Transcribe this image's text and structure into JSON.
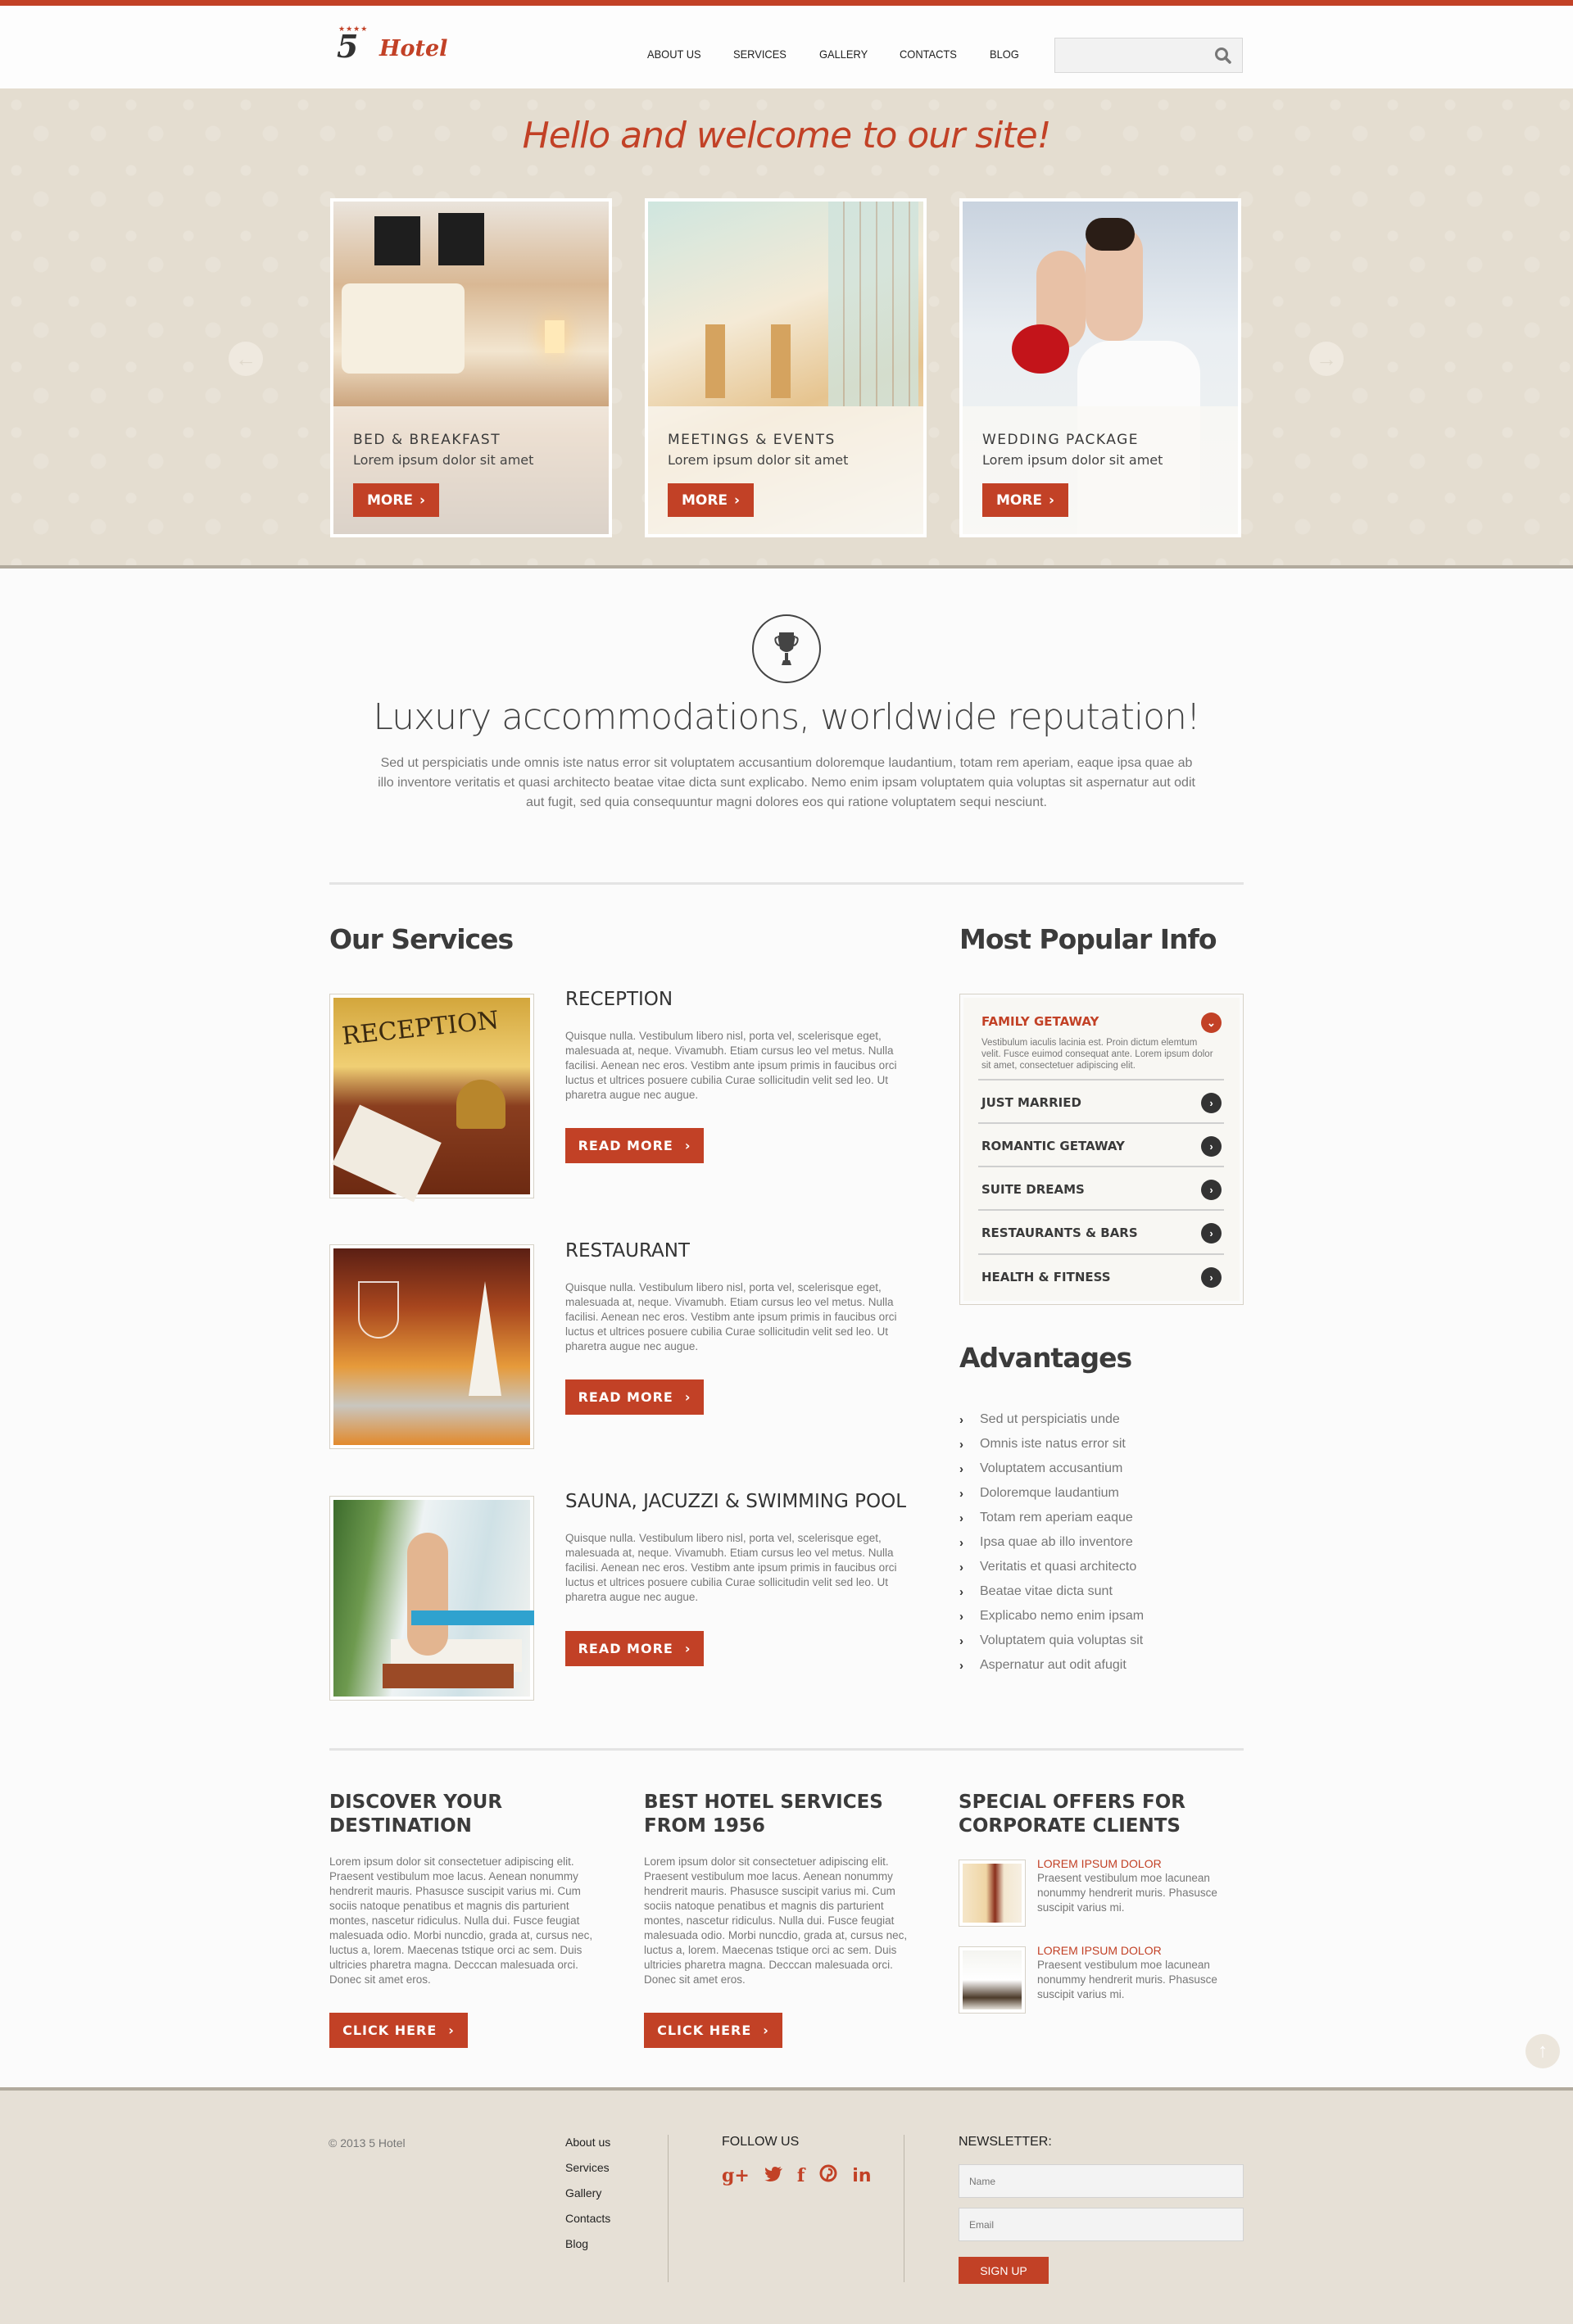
{
  "brand": {
    "number": "5",
    "stars": "★★★★",
    "name": "Hotel",
    "accent_color": "#c24126"
  },
  "nav": {
    "items": [
      "ABOUT US",
      "SERVICES",
      "GALLERY",
      "CONTACTS",
      "BLOG"
    ]
  },
  "search": {
    "placeholder": "",
    "icon": "search-icon"
  },
  "slider": {
    "title": "Hello and welcome to our site!",
    "prev_icon": "arrow-left-icon",
    "next_icon": "arrow-right-icon",
    "cards": [
      {
        "title": "BED & BREAKFAST",
        "subtitle": "Lorem ipsum dolor sit amet",
        "button": "MORE"
      },
      {
        "title": "MEETINGS & EVENTS",
        "subtitle": "Lorem ipsum dolor sit amet",
        "button": "MORE"
      },
      {
        "title": "WEDDING PACKAGE",
        "subtitle": "Lorem ipsum dolor sit amet",
        "button": "MORE"
      }
    ]
  },
  "intro": {
    "icon": "trophy-icon",
    "headline": "Luxury accommodations, worldwide reputation!",
    "text": "Sed ut perspiciatis unde omnis iste natus error sit voluptatem accusantium doloremque laudantium, totam rem aperiam, eaque ipsa quae ab illo inventore veritatis et quasi architecto beatae vitae dicta sunt explicabo. Nemo enim ipsam voluptatem quia voluptas sit aspernatur aut odit aut fugit, sed quia consequuntur magni dolores eos qui ratione voluptatem sequi nesciunt."
  },
  "services": {
    "heading": "Our Services",
    "items": [
      {
        "title": "RECEPTION",
        "text": "Quisque nulla. Vestibulum libero nisl, porta vel, scelerisque eget, malesuada at, neque. Vivamubh. Etiam cursus leo vel metus. Nulla facilisi. Aenean nec eros. Vestibm ante ipsum primis in faucibus orci luctus et ultrices posuere cubilia Curae sollicitudin velit sed leo. Ut pharetra augue nec augue.",
        "button": "READ MORE"
      },
      {
        "title": "RESTAURANT",
        "text": "Quisque nulla. Vestibulum libero nisl, porta vel, scelerisque eget, malesuada at, neque. Vivamubh. Etiam cursus leo vel metus. Nulla facilisi. Aenean nec eros. Vestibm ante ipsum primis in faucibus orci luctus et ultrices posuere cubilia Curae sollicitudin velit sed leo. Ut pharetra augue nec augue.",
        "button": "READ MORE"
      },
      {
        "title": "SAUNA, JACUZZI & SWIMMING POOL",
        "text": "Quisque nulla. Vestibulum libero nisl, porta vel, scelerisque eget, malesuada at, neque. Vivamubh. Etiam cursus leo vel metus. Nulla facilisi. Aenean nec eros. Vestibm ante ipsum primis in faucibus orci luctus et ultrices posuere cubilia Curae sollicitudin velit sed leo. Ut pharetra augue nec augue.",
        "button": "READ MORE"
      }
    ]
  },
  "popular": {
    "heading": "Most Popular Info",
    "open_item": {
      "title": "FAMILY GETAWAY",
      "text": "Vestibulum iaculis lacinia est. Proin dictum elemtum velit. Fusce euimod consequat ante. Lorem ipsum dolor sit amet, consectetuer adipiscing elit."
    },
    "items": [
      "JUST MARRIED",
      "ROMANTIC GETAWAY",
      "SUITE DREAMS",
      "RESTAURANTS & BARS",
      "HEALTH & FITNESS"
    ]
  },
  "advantages": {
    "heading": "Advantages",
    "items": [
      "Sed ut perspiciatis unde",
      "Omnis iste natus error sit",
      "Voluptatem accusantium",
      "Doloremque laudantium",
      "Totam rem aperiam eaque",
      "Ipsa quae ab illo inventore",
      "Veritatis et quasi architecto",
      "Beatae vitae dicta sunt",
      "Explicabo nemo enim ipsam",
      "Voluptatem quia voluptas sit",
      "Aspernatur aut odit afugit"
    ]
  },
  "bottom": {
    "columns": [
      {
        "title_line1": "DISCOVER YOUR",
        "title_line2": "DESTINATION",
        "text": "Lorem ipsum dolor sit consectetuer adipiscing elit. Praesent vestibulum moe lacus. Aenean nonummy hendrerit mauris. Phasusce suscipit varius mi. Cum sociis natoque penatibus et magnis dis parturient montes, nascetur ridiculus. Nulla dui. Fusce feugiat malesuada odio. Morbi nuncdio, grada at, cursus nec, luctus a, lorem. Maecenas tstique orci ac sem. Duis ultricies pharetra magna. Decccan malesuada orci. Donec sit amet eros.",
        "button": "CLICK HERE"
      },
      {
        "title_line1": "BEST HOTEL SERVICES",
        "title_line2": "FROM 1956",
        "text": "Lorem ipsum dolor sit consectetuer adipiscing elit. Praesent vestibulum moe lacus. Aenean nonummy hendrerit mauris. Phasusce suscipit varius mi. Cum sociis natoque penatibus et magnis dis parturient montes, nascetur ridiculus. Nulla dui. Fusce feugiat malesuada odio. Morbi nuncdio, grada at, cursus nec, luctus a, lorem. Maecenas tstique orci ac sem. Duis ultricies pharetra magna. Decccan malesuada orci. Donec sit amet eros.",
        "button": "CLICK HERE"
      }
    ],
    "offers": {
      "title_line1": "SPECIAL OFFERS FOR",
      "title_line2": "CORPORATE CLIENTS",
      "items": [
        {
          "title": "LOREM IPSUM DOLOR",
          "text": "Praesent vestibulum moe lacunean nonummy hendrerit muris. Phasusce suscipit varius mi."
        },
        {
          "title": "LOREM IPSUM DOLOR",
          "text": "Praesent vestibulum moe lacunean nonummy hendrerit muris. Phasusce suscipit varius mi."
        }
      ]
    }
  },
  "footer": {
    "copyright": "© 2013 5 Hotel",
    "links": [
      "About us",
      "Services",
      "Gallery",
      "Contacts",
      "Blog"
    ],
    "follow_title": "FOLLOW US",
    "social": [
      {
        "name": "google-plus-icon",
        "glyph": "g+"
      },
      {
        "name": "twitter-icon",
        "glyph": "t"
      },
      {
        "name": "facebook-icon",
        "glyph": "f"
      },
      {
        "name": "pinterest-icon",
        "glyph": "p"
      },
      {
        "name": "linkedin-icon",
        "glyph": "in"
      }
    ],
    "newsletter_title": "NEWSLETTER:",
    "name_placeholder": "Name",
    "email_placeholder": "Email",
    "signup_label": "SIGN UP"
  },
  "back_to_top_icon": "arrow-up-icon"
}
